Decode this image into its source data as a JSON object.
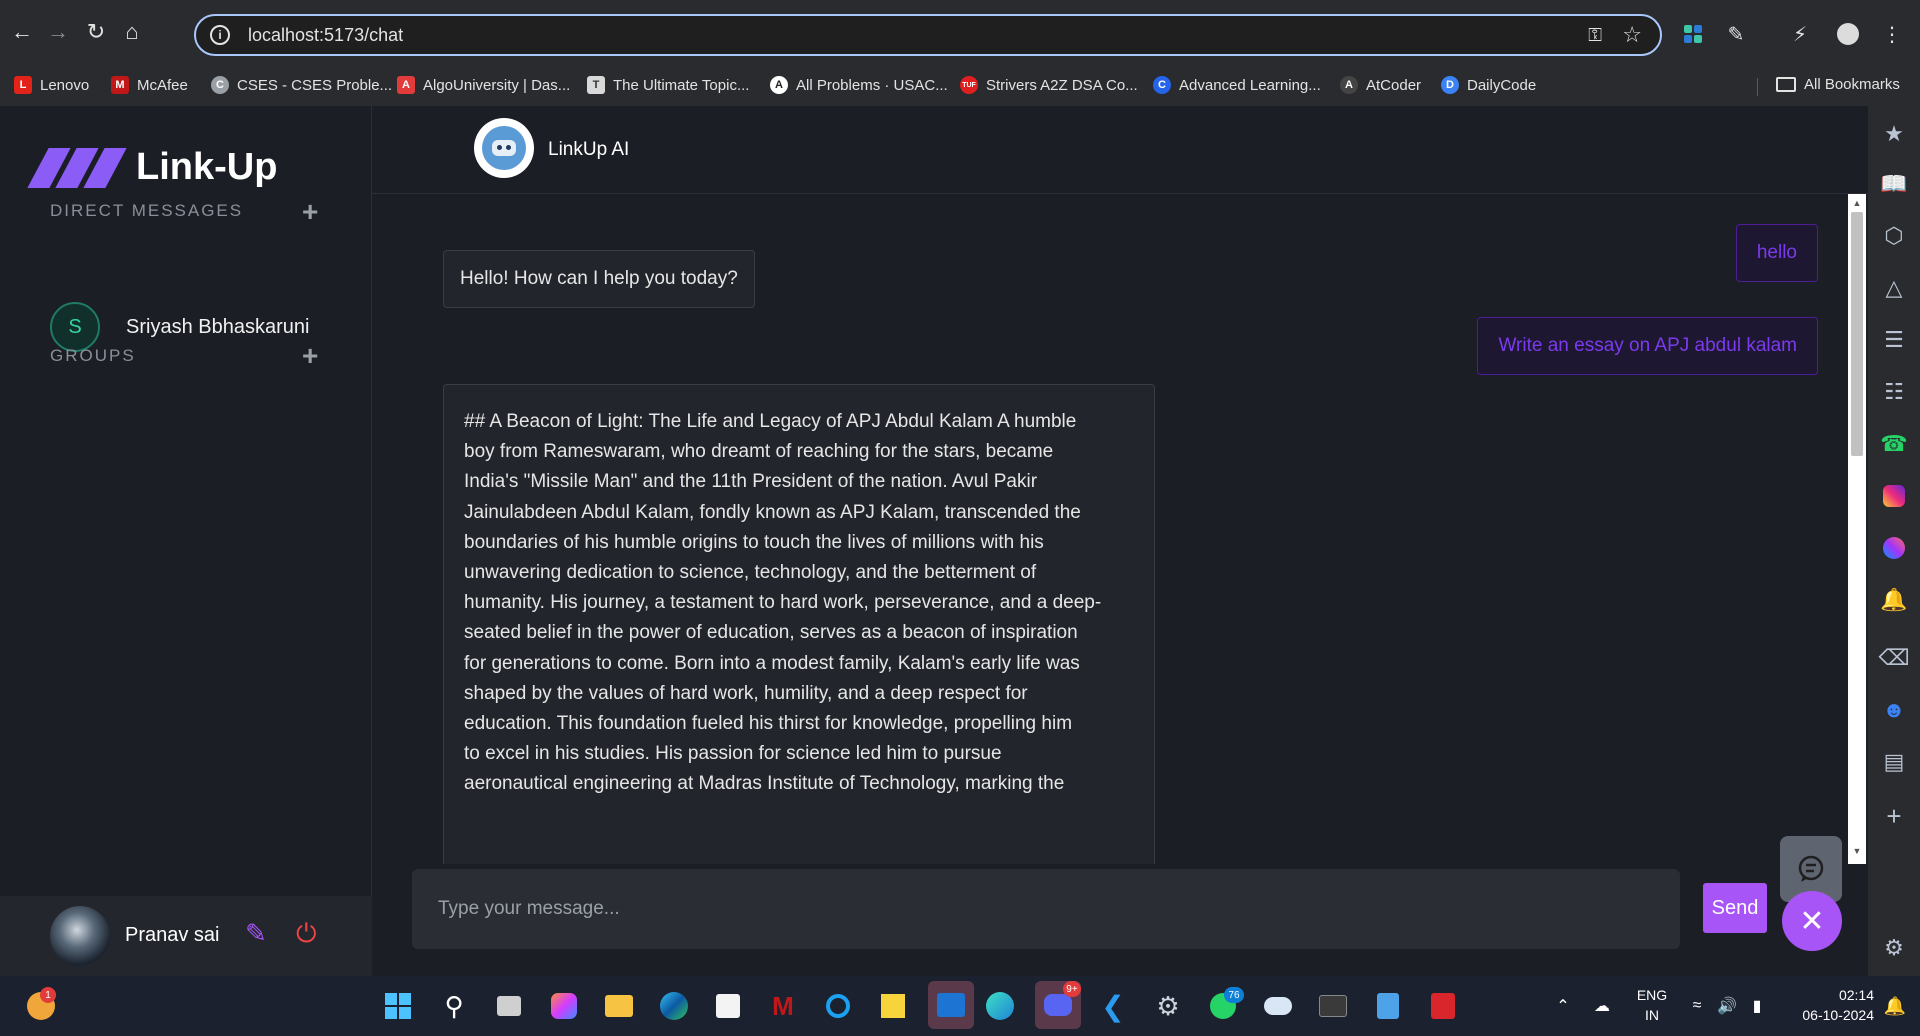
{
  "browser": {
    "url": "localhost:5173/chat",
    "bookmarks": [
      {
        "label": "Lenovo",
        "color": "#e2231a",
        "glyph": "L"
      },
      {
        "label": "McAfee",
        "color": "#c01818",
        "glyph": "M"
      },
      {
        "label": "CSES - CSES Proble...",
        "color": "#9aa0a6",
        "glyph": "C"
      },
      {
        "label": "AlgoUniversity | Das...",
        "color": "#e23b3b",
        "glyph": "A"
      },
      {
        "label": "The Ultimate Topic...",
        "color": "#d9d9d9",
        "glyph": "T"
      },
      {
        "label": "All Problems · USAC...",
        "color": "#ffffff",
        "glyph": "A"
      },
      {
        "label": "Strivers A2Z DSA Co...",
        "color": "#e02020",
        "glyph": "T"
      },
      {
        "label": "Advanced Learning...",
        "color": "#2563eb",
        "glyph": "C"
      },
      {
        "label": "AtCoder",
        "color": "#444444",
        "glyph": "A"
      },
      {
        "label": "DailyCode",
        "color": "#3b82f6",
        "glyph": "D"
      }
    ],
    "all_bookmarks": "All Bookmarks"
  },
  "app": {
    "brand": "Link-Up",
    "direct_messages_heading": "DIRECT MESSAGES",
    "groups_heading": "GROUPS",
    "contacts": [
      {
        "initial": "S",
        "name": "Sriyash Bbhaskaruni"
      }
    ],
    "user": {
      "name": "Pranav sai"
    }
  },
  "chat": {
    "bot_name": "LinkUp AI",
    "messages": [
      {
        "role": "user",
        "text": "hello"
      },
      {
        "role": "bot",
        "text": "Hello! How can I help you today?"
      },
      {
        "role": "user",
        "text": "Write an essay on APJ abdul kalam"
      },
      {
        "role": "bot",
        "lines": [
          "## A Beacon of Light: The Life and Legacy of APJ Abdul Kalam A humble",
          "boy from Rameswaram, who dreamt of reaching for the stars, became",
          "India's \"Missile Man\" and the 11th President of the nation. Avul Pakir",
          "Jainulabdeen Abdul Kalam, fondly known as APJ Kalam, transcended the",
          "boundaries of his humble origins to touch the lives of millions with his",
          "unwavering dedication to science, technology, and the betterment of",
          "humanity. His journey, a testament to hard work, perseverance, and a deep-",
          "seated belief in the power of education, serves as a beacon of inspiration",
          "for generations to come. Born into a modest family, Kalam's early life was",
          "shaped by the values of hard work, humility, and a deep respect for",
          "education. This foundation fueled his thirst for knowledge, propelling him",
          "to excel in his studies. His passion for science led him to pursue",
          "aeronautical engineering at Madras Institute of Technology, marking the"
        ]
      }
    ],
    "input_placeholder": "Type your message...",
    "send_label": "Send"
  },
  "taskbar": {
    "language": "ENG",
    "region": "IN",
    "time": "02:14",
    "date": "06-10-2024",
    "badges": {
      "weather": "1",
      "discord": "9+",
      "whatsapp": "76"
    }
  }
}
